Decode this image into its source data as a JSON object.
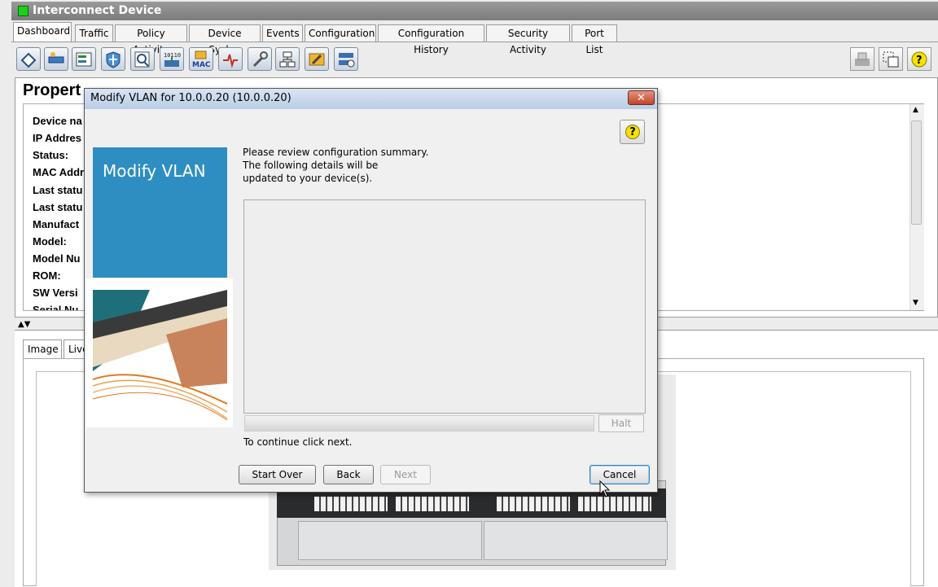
{
  "window": {
    "title": "Interconnect Device"
  },
  "tabs": [
    {
      "label": "Dashboard"
    },
    {
      "label": "Traffic"
    },
    {
      "label": "Policy Activity"
    },
    {
      "label": "Device Syslog"
    },
    {
      "label": "Events"
    },
    {
      "label": "Configuration"
    },
    {
      "label": "Configuration History"
    },
    {
      "label": "Security Activity"
    },
    {
      "label": "Port List"
    }
  ],
  "toolbar": {
    "mac_label": "MAC",
    "binary_label": "101101"
  },
  "properties": {
    "title": "Propert",
    "labels": [
      "Device na",
      "IP Addres",
      "Status:",
      "MAC Addr",
      "Last statu",
      "Last statu",
      "Manufact",
      "Model:",
      "Model Nu",
      "ROM:",
      "SW Versi",
      "Serial Nu"
    ]
  },
  "lower": {
    "splitter": "▲▼",
    "tabs": [
      {
        "label": "Image"
      },
      {
        "label": "Live"
      }
    ]
  },
  "dialog": {
    "title": "Modify VLAN for 10.0.0.20 (10.0.0.20)",
    "close_symbol": "✕",
    "help_symbol": "?",
    "side_title": "Modify VLAN",
    "instructions": [
      "Please review configuration summary.",
      "The following details will be",
      "updated to your device(s)."
    ],
    "halt_label": "Halt",
    "continue_text": "To continue click next.",
    "buttons": {
      "start_over": "Start Over",
      "back": "Back",
      "next": "Next",
      "cancel": "Cancel"
    }
  },
  "colors": {
    "side_panel_blue": "#2e8ec2",
    "status_led": "#19d219",
    "title_bar": "#8a8a8a"
  },
  "icons": [
    "vlan-icon",
    "network-icon",
    "config-icon",
    "security-shield-icon",
    "zoom-icon",
    "download-icon",
    "mac-icon",
    "signal-icon",
    "wrench-icon",
    "topology-icon",
    "tools-icon",
    "device-list-icon",
    "printer-icon",
    "select-icon",
    "help-icon"
  ]
}
